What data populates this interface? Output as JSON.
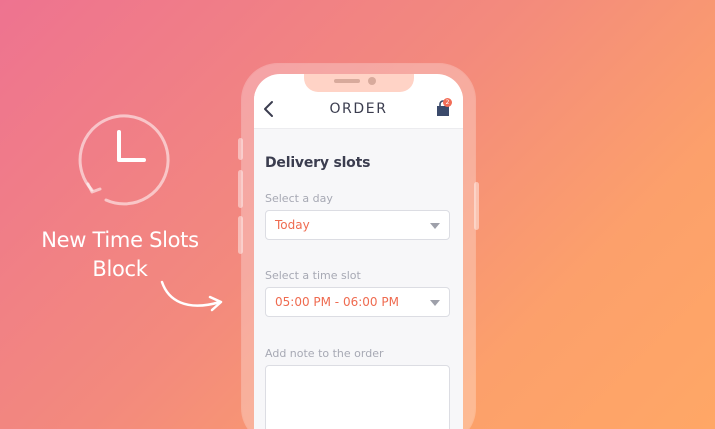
{
  "promo": {
    "headline_line1": "New Time Slots",
    "headline_line2": "Block",
    "icons": [
      "clock-icon",
      "curved-arrow-icon"
    ]
  },
  "app": {
    "header": {
      "title": "ORDER",
      "back_icon": "chevron-left-icon",
      "cart_icon": "shopping-bag-icon",
      "cart_badge": "2"
    },
    "section_title": "Delivery slots",
    "day_field": {
      "label": "Select a day",
      "value": "Today"
    },
    "time_field": {
      "label": "Select a time slot",
      "value": "05:00 PM - 06:00 PM"
    },
    "note_field": {
      "label": "Add note to the order",
      "value": ""
    }
  },
  "colors": {
    "gradient_start": "#ee7390",
    "gradient_end": "#ffa766",
    "accent": "#ef6b50",
    "text_dark": "#3b3d4f",
    "text_muted": "#a7a9b4"
  }
}
